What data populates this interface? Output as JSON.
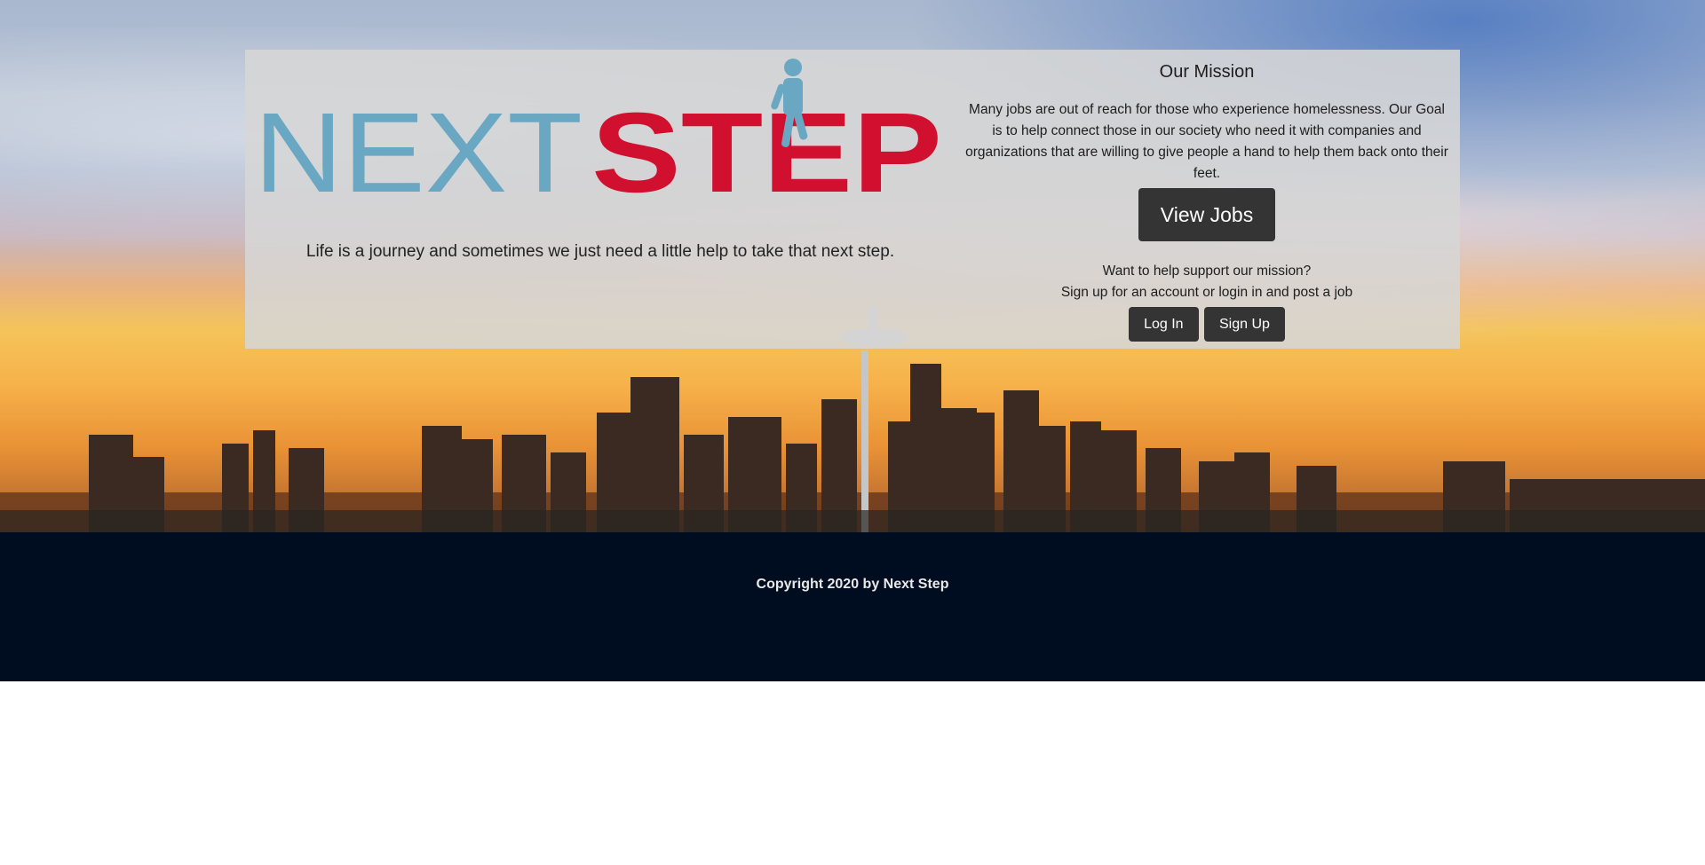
{
  "brand": {
    "logo_text_part1": "NEXT",
    "logo_text_part2": "STEP",
    "logo_color_primary": "#6aa7c2",
    "logo_color_accent": "#d0102e",
    "tagline": "Life is a journey and sometimes we just need a little help to take that next step."
  },
  "mission": {
    "title": "Our Mission",
    "text": "Many jobs are out of reach for those who experience homelessness. Our Goal is to help connect those in our society who need it with companies and organizations that are willing to give people a hand to help them back onto their feet.",
    "view_jobs_label": "View Jobs",
    "support_line1": "Want to help support our mission?",
    "support_line2": "Sign up for an account or login in and post a job",
    "login_label": "Log In",
    "signup_label": "Sign Up"
  },
  "footer": {
    "copyright": "Copyright 2020 by Next Step",
    "background_color": "#000d20"
  },
  "hero": {
    "background": "seattle-skyline-sunset-photo"
  }
}
